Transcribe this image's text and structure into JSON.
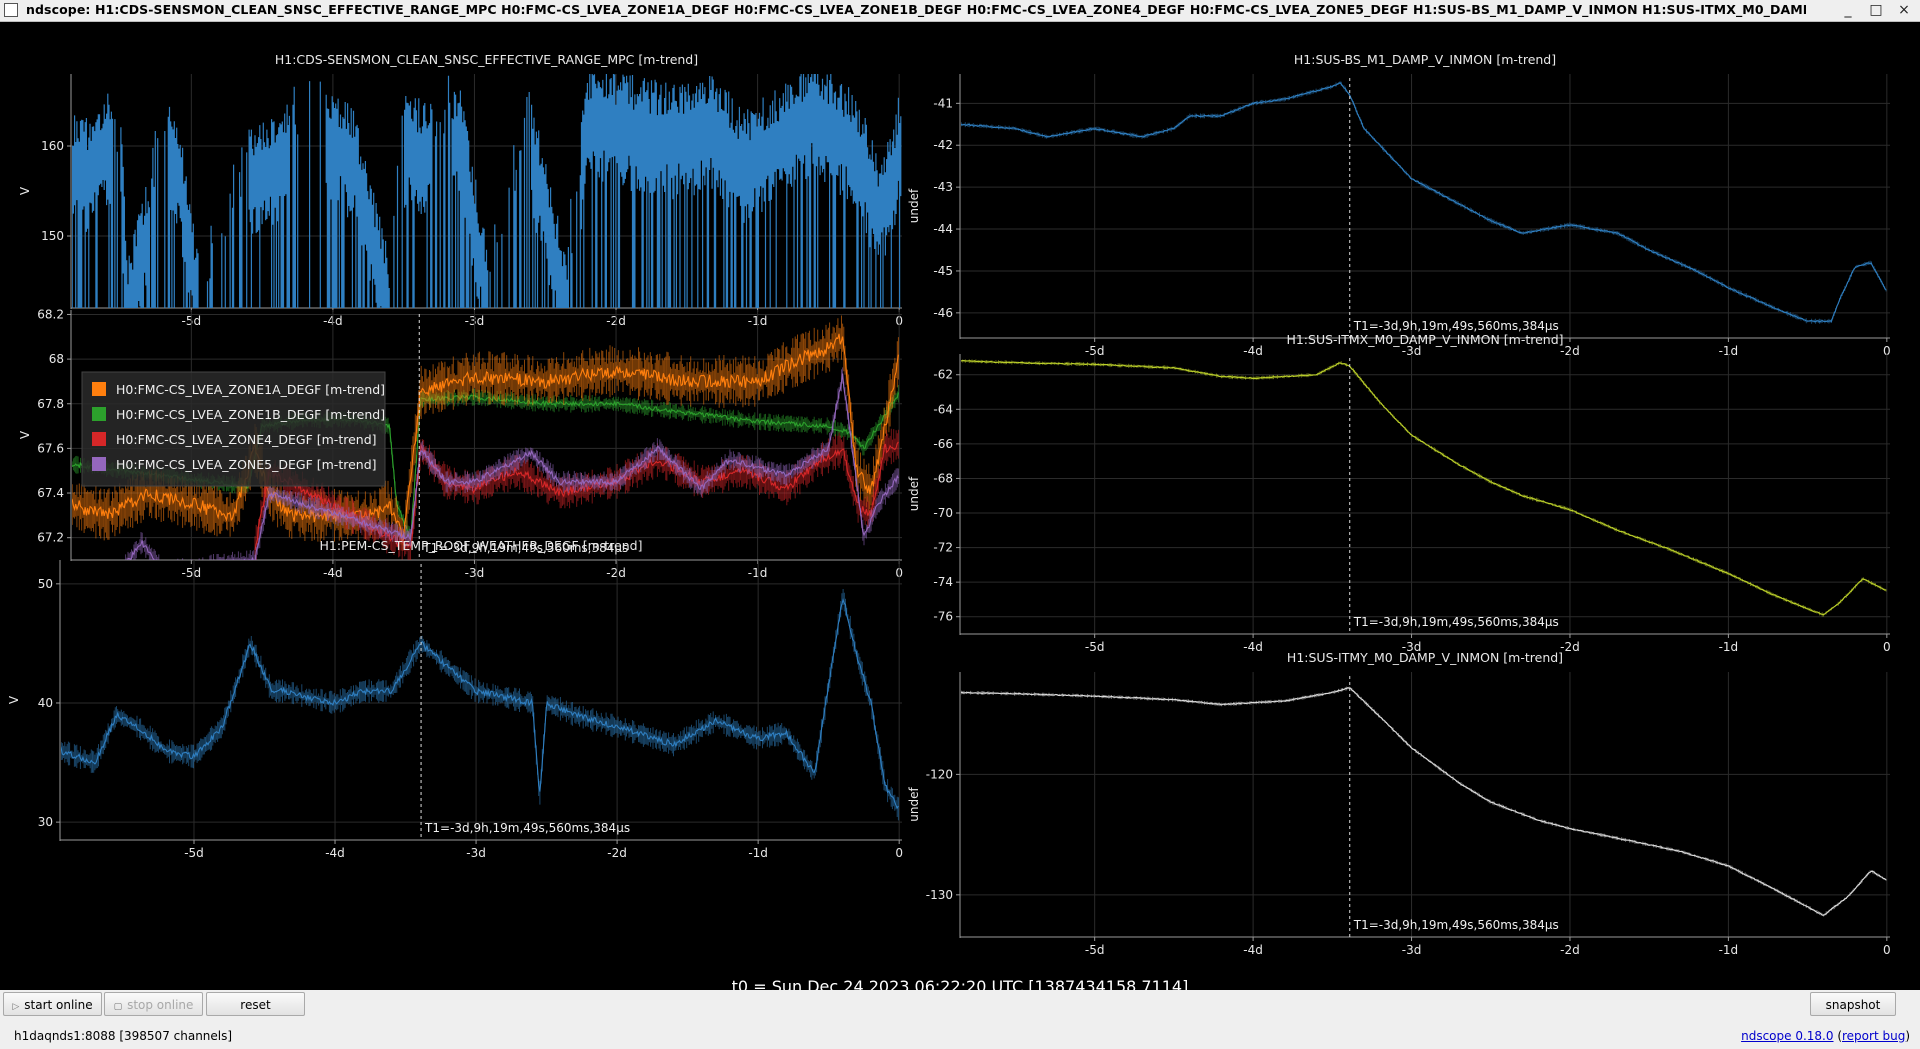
{
  "window": {
    "title": "ndscope: H1:CDS-SENSMON_CLEAN_SNSC_EFFECTIVE_RANGE_MPC H0:FMC-CS_LVEA_ZONE1A_DEGF H0:FMC-CS_LVEA_ZONE1B_DEGF H0:FMC-CS_LVEA_ZONE4_DEGF H0:FMC-CS_LVEA_ZONE5_DEGF H1:SUS-BS_M1_DAMP_V_INMON H1:SUS-ITMX_M0_DAMP_V_INMON H1:SU",
    "minimize_glyph": "_",
    "maximize_glyph": "□",
    "close_glyph": "×"
  },
  "cursor_label": "T1=-3d,9h,19m,49s,560ms,384µs",
  "t0_label": "t0 = Sun Dec 24 2023 06:22:20 UTC [1387434158.7114]",
  "buttons": {
    "start_online": "start online",
    "stop_online": "stop online",
    "reset": "reset",
    "snapshot": "snapshot"
  },
  "status": {
    "server": "h1daqnds1:8088  [398507 channels]",
    "version_link": "ndscope 0.18.0",
    "report_bug": "report bug"
  },
  "chart_data": [
    {
      "id": "p1",
      "type": "line",
      "title": "H1:CDS-SENSMON_CLEAN_SNSC_EFFECTIVE_RANGE_MPC [m-trend]",
      "ylabel": "V",
      "xlabel": "",
      "xlim": [
        -5.85,
        0.02
      ],
      "ylim": [
        142,
        168
      ],
      "xticks": [
        -5,
        -4,
        -3,
        -2,
        -1,
        0
      ],
      "xtick_labels": [
        "-5d",
        "-4d",
        "-3d",
        "-2d",
        "-1d",
        "0"
      ],
      "yticks": [
        150,
        160
      ],
      "ytick_labels": [
        "150",
        "160"
      ],
      "cursor": null,
      "series": [
        {
          "name": "H1:CDS-SENSMON_CLEAN_SNSC_EFFECTIVE_RANGE_MPC",
          "color": "#2f7fc1",
          "band": true,
          "spike_floor": 142,
          "density": 0.7,
          "x": [
            -5.85,
            -5.75,
            -5.6,
            -5.5,
            -5.45,
            -5.2,
            -5.1,
            -4.95,
            -4.6,
            -4.3,
            -4.0,
            -3.85,
            -3.6,
            -3.5,
            -3.3,
            -3.1,
            -2.9,
            -2.6,
            -2.35,
            -2.2,
            -1.9,
            -1.6,
            -1.3,
            -1.1,
            -0.9,
            -0.6,
            -0.3,
            -0.15,
            -0.05,
            0.0
          ],
          "y": [
            158,
            157,
            160,
            159,
            142,
            157,
            158,
            142,
            156,
            159,
            161,
            158,
            142,
            160,
            159,
            161,
            142,
            160,
            142,
            163,
            162,
            161,
            162,
            158,
            160,
            164,
            160,
            153,
            156,
            160
          ],
          "gaps": [
            [
              -5.55,
              -5.5
            ],
            [
              -5.3,
              -5.15
            ],
            [
              -4.95,
              -4.6
            ],
            [
              -4.3,
              -4.05
            ],
            [
              -3.6,
              -3.5
            ],
            [
              -3.3,
              -3.15
            ],
            [
              -2.9,
              -2.6
            ],
            [
              -2.35,
              -2.25
            ]
          ]
        }
      ]
    },
    {
      "id": "p2",
      "type": "line",
      "title": "",
      "ylabel": "V",
      "xlabel": "",
      "xlim": [
        -5.85,
        0.02
      ],
      "ylim": [
        67.1,
        68.22
      ],
      "xticks": [
        -5,
        -4,
        -3,
        -2,
        -1,
        0
      ],
      "xtick_labels": [
        "-5d",
        "-4d",
        "-3d",
        "-2d",
        "-1d",
        "0"
      ],
      "yticks": [
        67.2,
        67.4,
        67.6,
        67.8,
        68,
        68.2
      ],
      "ytick_labels": [
        "67.2",
        "67.4",
        "67.6",
        "67.8",
        "68",
        "68.2"
      ],
      "cursor": -3.39,
      "legend_position": "top-left",
      "series": [
        {
          "name": "H0:FMC-CS_LVEA_ZONE1B_DEGF [m-trend]",
          "color": "#2ca02c",
          "noise": 0.02,
          "x": [
            -5.85,
            -5.5,
            -5.1,
            -4.6,
            -4.5,
            -4.2,
            -3.85,
            -3.6,
            -3.55,
            -3.45,
            -3.38,
            -3.0,
            -2.5,
            -2.0,
            -1.5,
            -1.0,
            -0.5,
            -0.35,
            -0.25,
            -0.1,
            0.0
          ],
          "y": [
            67.53,
            67.5,
            67.47,
            67.43,
            67.7,
            67.73,
            67.73,
            67.7,
            67.35,
            67.2,
            67.82,
            67.83,
            67.8,
            67.8,
            67.76,
            67.72,
            67.7,
            67.67,
            67.6,
            67.75,
            67.85
          ]
        },
        {
          "name": "H0:FMC-CS_LVEA_ZONE1A_DEGF [m-trend]",
          "color": "#ff7f0e",
          "noise": 0.06,
          "x": [
            -5.85,
            -5.6,
            -5.3,
            -5.0,
            -4.7,
            -4.55,
            -4.45,
            -4.3,
            -4.0,
            -3.7,
            -3.6,
            -3.5,
            -3.38,
            -3.0,
            -2.5,
            -2.0,
            -1.5,
            -1.0,
            -0.7,
            -0.5,
            -0.4,
            -0.3,
            -0.2,
            -0.1,
            0.0
          ],
          "y": [
            67.35,
            67.3,
            67.4,
            67.35,
            67.3,
            67.6,
            67.4,
            67.3,
            67.3,
            67.3,
            67.35,
            67.2,
            67.85,
            67.92,
            67.9,
            67.95,
            67.9,
            67.9,
            68.0,
            68.05,
            68.1,
            67.5,
            67.4,
            67.7,
            68.02
          ]
        },
        {
          "name": "H0:FMC-CS_LVEA_ZONE4_DEGF [m-trend]",
          "color": "#d62728",
          "noise": 0.04,
          "x": [
            -4.55,
            -4.45,
            -3.45,
            -3.38,
            -3.2,
            -3.0,
            -2.7,
            -2.4,
            -2.0,
            -1.7,
            -1.4,
            -1.1,
            -0.8,
            -0.55,
            -0.4,
            -0.3,
            -0.2,
            -0.1,
            0.0
          ],
          "y": [
            67.15,
            67.5,
            67.15,
            67.6,
            67.45,
            67.42,
            67.5,
            67.4,
            67.45,
            67.55,
            67.45,
            67.5,
            67.42,
            67.55,
            67.6,
            67.35,
            67.3,
            67.6,
            67.62
          ]
        },
        {
          "name": "H0:FMC-CS_LVEA_ZONE5_DEGF [m-trend]",
          "color": "#9467bd",
          "noise": 0.025,
          "x": [
            -5.85,
            -5.5,
            -5.35,
            -5.2,
            -4.55,
            -4.45,
            -3.45,
            -3.38,
            -3.2,
            -3.0,
            -2.6,
            -2.4,
            -2.0,
            -1.7,
            -1.4,
            -1.2,
            -0.8,
            -0.5,
            -0.4,
            -0.25,
            -0.15,
            0.0
          ],
          "y": [
            67.0,
            67.05,
            67.18,
            67.05,
            67.1,
            67.4,
            67.2,
            67.6,
            67.45,
            67.45,
            67.58,
            67.45,
            67.45,
            67.6,
            67.42,
            67.55,
            67.48,
            67.6,
            67.93,
            67.2,
            67.35,
            67.48
          ]
        }
      ]
    },
    {
      "id": "p3",
      "type": "line",
      "title": "H1:PEM-CS_TEMP_ROOF_WEATHER_DEGF [m-trend]",
      "ylabel": "V",
      "xlabel": "",
      "xlim": [
        -5.95,
        0.02
      ],
      "ylim": [
        28.5,
        52
      ],
      "xticks": [
        -5,
        -4,
        -3,
        -2,
        -1,
        0
      ],
      "xtick_labels": [
        "-5d",
        "-4d",
        "-3d",
        "-2d",
        "-1d",
        "0"
      ],
      "yticks": [
        30,
        40,
        50
      ],
      "ytick_labels": [
        "30",
        "40",
        "50"
      ],
      "cursor": -3.39,
      "series": [
        {
          "name": "H1:PEM-CS_TEMP_ROOF_WEATHER_DEGF",
          "color": "#2f7fc1",
          "noise": 0.5,
          "x": [
            -5.95,
            -5.7,
            -5.55,
            -5.4,
            -5.2,
            -5.0,
            -4.8,
            -4.6,
            -4.45,
            -4.35,
            -4.2,
            -4.0,
            -3.8,
            -3.6,
            -3.39,
            -3.2,
            -3.0,
            -2.8,
            -2.6,
            -2.55,
            -2.5,
            -2.3,
            -2.0,
            -1.6,
            -1.3,
            -1.0,
            -0.8,
            -0.6,
            -0.4,
            -0.3,
            -0.2,
            -0.1,
            0.0
          ],
          "y": [
            36,
            35,
            39,
            38,
            36,
            35.5,
            38,
            45,
            41,
            41,
            40.5,
            40,
            41,
            41,
            45,
            43,
            41,
            40.5,
            40,
            32,
            40,
            39,
            38,
            36.5,
            38.5,
            37,
            37.5,
            34,
            49,
            44,
            40,
            33,
            31
          ]
        }
      ]
    },
    {
      "id": "p4",
      "type": "line",
      "title": "H1:SUS-BS_M1_DAMP_V_INMON [m-trend]",
      "ylabel": "undef",
      "xlabel": "",
      "xlim": [
        -5.85,
        0.02
      ],
      "ylim": [
        -46.6,
        -40.3
      ],
      "xticks": [
        -5,
        -4,
        -3,
        -2,
        -1,
        0
      ],
      "xtick_labels": [
        "-5d",
        "-4d",
        "-3d",
        "-2d",
        "-1d",
        "0"
      ],
      "yticks": [
        -41,
        -42,
        -43,
        -44,
        -45,
        -46
      ],
      "ytick_labels": [
        "-41",
        "-42",
        "-43",
        "-44",
        "-45",
        "-46"
      ],
      "cursor": -3.39,
      "series": [
        {
          "name": "H1:SUS-BS_M1_DAMP_V_INMON",
          "color": "#2f7fc1",
          "noise": 0.03,
          "x": [
            -5.85,
            -5.5,
            -5.3,
            -5.0,
            -4.7,
            -4.5,
            -4.4,
            -4.2,
            -4.0,
            -3.8,
            -3.5,
            -3.45,
            -3.39,
            -3.3,
            -3.0,
            -2.7,
            -2.5,
            -2.3,
            -2.0,
            -1.7,
            -1.5,
            -1.2,
            -1.0,
            -0.7,
            -0.5,
            -0.35,
            -0.3,
            -0.2,
            -0.1,
            0.0
          ],
          "y": [
            -41.5,
            -41.6,
            -41.8,
            -41.6,
            -41.8,
            -41.6,
            -41.3,
            -41.3,
            -41.0,
            -40.9,
            -40.6,
            -40.5,
            -40.8,
            -41.6,
            -42.8,
            -43.4,
            -43.8,
            -44.1,
            -43.9,
            -44.1,
            -44.5,
            -45.0,
            -45.4,
            -45.9,
            -46.2,
            -46.2,
            -45.7,
            -44.9,
            -44.8,
            -45.5
          ]
        }
      ]
    },
    {
      "id": "p5",
      "type": "line",
      "title": "H1:SUS-ITMX_M0_DAMP_V_INMON [m-trend]",
      "ylabel": "undef",
      "xlabel": "",
      "xlim": [
        -5.85,
        0.02
      ],
      "ylim": [
        -77,
        -60.8
      ],
      "xticks": [
        -5,
        -4,
        -3,
        -2,
        -1,
        0
      ],
      "xtick_labels": [
        "-5d",
        "-4d",
        "-3d",
        "-2d",
        "-1d",
        "0"
      ],
      "yticks": [
        -62,
        -64,
        -66,
        -68,
        -70,
        -72,
        -74,
        -76
      ],
      "ytick_labels": [
        "-62",
        "-64",
        "-66",
        "-68",
        "-70",
        "-72",
        "-74",
        "-76"
      ],
      "cursor": -3.39,
      "series": [
        {
          "name": "H1:SUS-ITMX_M0_DAMP_V_INMON",
          "color": "#bcd02a",
          "noise": 0.06,
          "x": [
            -5.85,
            -5.5,
            -5.0,
            -4.5,
            -4.2,
            -4.0,
            -3.6,
            -3.45,
            -3.39,
            -3.2,
            -3.0,
            -2.7,
            -2.5,
            -2.3,
            -2.0,
            -1.7,
            -1.4,
            -1.0,
            -0.7,
            -0.4,
            -0.3,
            -0.15,
            0.0
          ],
          "y": [
            -61.2,
            -61.3,
            -61.4,
            -61.6,
            -62.1,
            -62.2,
            -62.0,
            -61.3,
            -61.5,
            -63.6,
            -65.5,
            -67.2,
            -68.2,
            -69.0,
            -69.8,
            -71.0,
            -72.0,
            -73.5,
            -74.8,
            -75.9,
            -75.2,
            -73.8,
            -74.5
          ]
        }
      ]
    },
    {
      "id": "p6",
      "type": "line",
      "title": "H1:SUS-ITMY_M0_DAMP_V_INMON [m-trend]",
      "ylabel": "undef",
      "xlabel": "",
      "xlim": [
        -5.85,
        0.02
      ],
      "ylim": [
        -133.5,
        -111.5
      ],
      "xticks": [
        -5,
        -4,
        -3,
        -2,
        -1,
        0
      ],
      "xtick_labels": [
        "-5d",
        "-4d",
        "-3d",
        "-2d",
        "-1d",
        "0"
      ],
      "yticks": [
        -120,
        -130
      ],
      "ytick_labels": [
        "-120",
        "-130"
      ],
      "cursor": -3.39,
      "series": [
        {
          "name": "H1:SUS-ITMY_M0_DAMP_V_INMON",
          "color": "#dcdcdc",
          "noise": 0.08,
          "x": [
            -5.85,
            -5.5,
            -5.0,
            -4.5,
            -4.2,
            -3.8,
            -3.5,
            -3.39,
            -3.2,
            -3.0,
            -2.7,
            -2.5,
            -2.2,
            -2.0,
            -1.7,
            -1.3,
            -1.0,
            -0.7,
            -0.4,
            -0.25,
            -0.1,
            0.0
          ],
          "y": [
            -113.2,
            -113.3,
            -113.5,
            -113.8,
            -114.2,
            -113.9,
            -113.2,
            -112.8,
            -115.2,
            -117.8,
            -120.7,
            -122.3,
            -123.8,
            -124.5,
            -125.3,
            -126.4,
            -127.6,
            -129.6,
            -131.7,
            -130.2,
            -128.0,
            -128.8
          ]
        }
      ]
    }
  ]
}
